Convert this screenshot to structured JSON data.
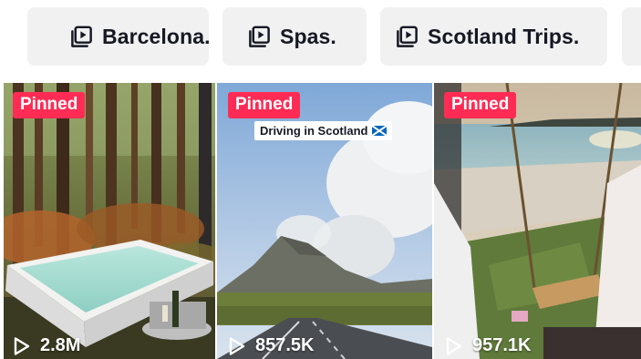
{
  "playlists": [
    {
      "label": "Barcelona.",
      "icon": "playlist-icon"
    },
    {
      "label": "Spas.",
      "icon": "playlist-icon"
    },
    {
      "label": "Scotland Trips.",
      "icon": "playlist-icon"
    },
    {
      "label": "",
      "icon": ""
    }
  ],
  "videos": [
    {
      "badge": "Pinned",
      "views": "2.8M",
      "caption": "",
      "icon": "play-icon"
    },
    {
      "badge": "Pinned",
      "views": "857.5K",
      "caption": "Driving in Scotland",
      "flag_icon": "scotland-flag-icon",
      "icon": "play-icon"
    },
    {
      "badge": "Pinned",
      "views": "957.1K",
      "caption": "",
      "icon": "play-icon"
    }
  ],
  "colors": {
    "pinned": "#fe2c55",
    "chip_bg": "#f1f1f2",
    "text": "#161823"
  }
}
